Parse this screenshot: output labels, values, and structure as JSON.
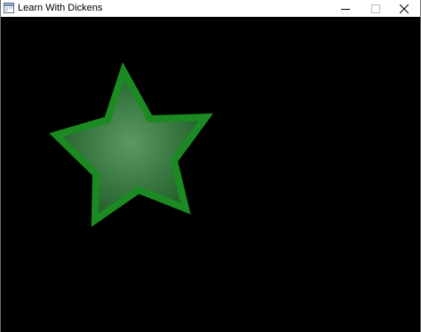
{
  "window": {
    "title": "Learn With Dickens",
    "controls": {
      "minimize_icon": "minimize-icon",
      "maximize_icon": "maximize-icon",
      "close_icon": "close-icon"
    }
  },
  "canvas": {
    "background": "#000000",
    "star": {
      "fill_center": "#5a9a62",
      "fill_edge": "#1e5a24",
      "stroke": "#1b8a22"
    }
  }
}
